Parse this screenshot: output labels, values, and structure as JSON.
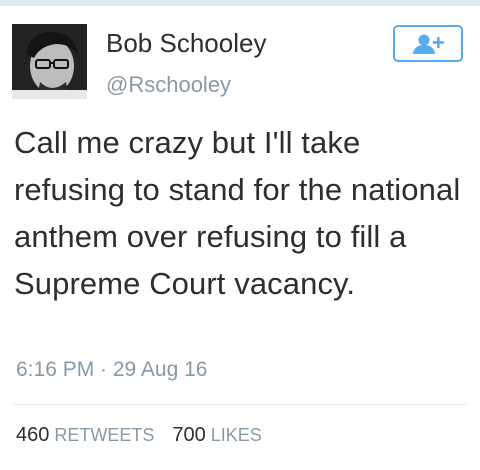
{
  "tweet": {
    "user": {
      "name": "Bob Schooley",
      "handle": "@Rschooley",
      "avatar_icon": "profile-photo"
    },
    "follow_button_icon": "follow-user-plus-icon",
    "text": "Call me crazy but I'll take refusing to stand for the national anthem over refusing to fill a Supreme Court vacancy.",
    "timestamp": "6:16 PM · 29 Aug 16",
    "stats": {
      "retweets_count": "460",
      "retweets_label": "RETWEETS",
      "likes_count": "700",
      "likes_label": "LIKES"
    }
  },
  "colors": {
    "accent": "#55acee",
    "text": "#292f33",
    "muted": "#8899a6",
    "divider": "#e1e8ed"
  }
}
